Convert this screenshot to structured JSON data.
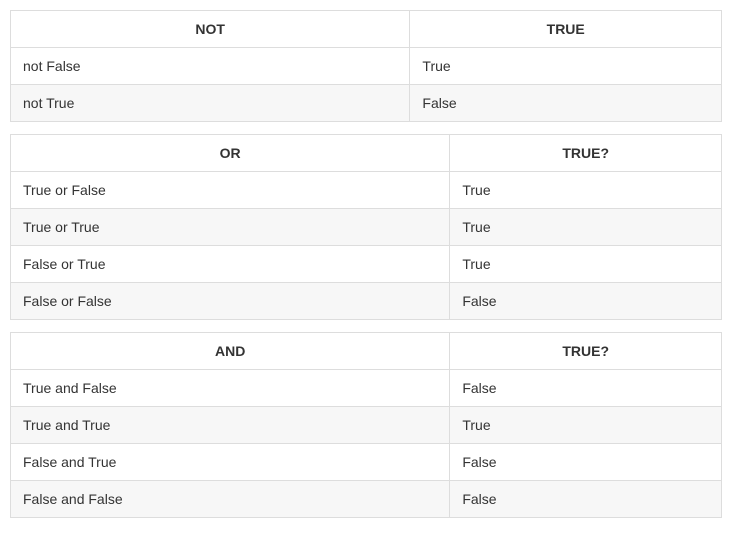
{
  "tables": [
    {
      "class": "not-table",
      "headers": [
        "NOT",
        "TRUE"
      ],
      "rows": [
        [
          "not False",
          "True"
        ],
        [
          "not True",
          "False"
        ]
      ]
    },
    {
      "class": "or-table",
      "headers": [
        "OR",
        "TRUE?"
      ],
      "rows": [
        [
          "True or False",
          "True"
        ],
        [
          "True or True",
          "True"
        ],
        [
          "False or True",
          "True"
        ],
        [
          "False or False",
          "False"
        ]
      ]
    },
    {
      "class": "and-table",
      "headers": [
        "AND",
        "TRUE?"
      ],
      "rows": [
        [
          "True and False",
          "False"
        ],
        [
          "True and True",
          "True"
        ],
        [
          "False and True",
          "False"
        ],
        [
          "False and False",
          "False"
        ]
      ]
    }
  ]
}
